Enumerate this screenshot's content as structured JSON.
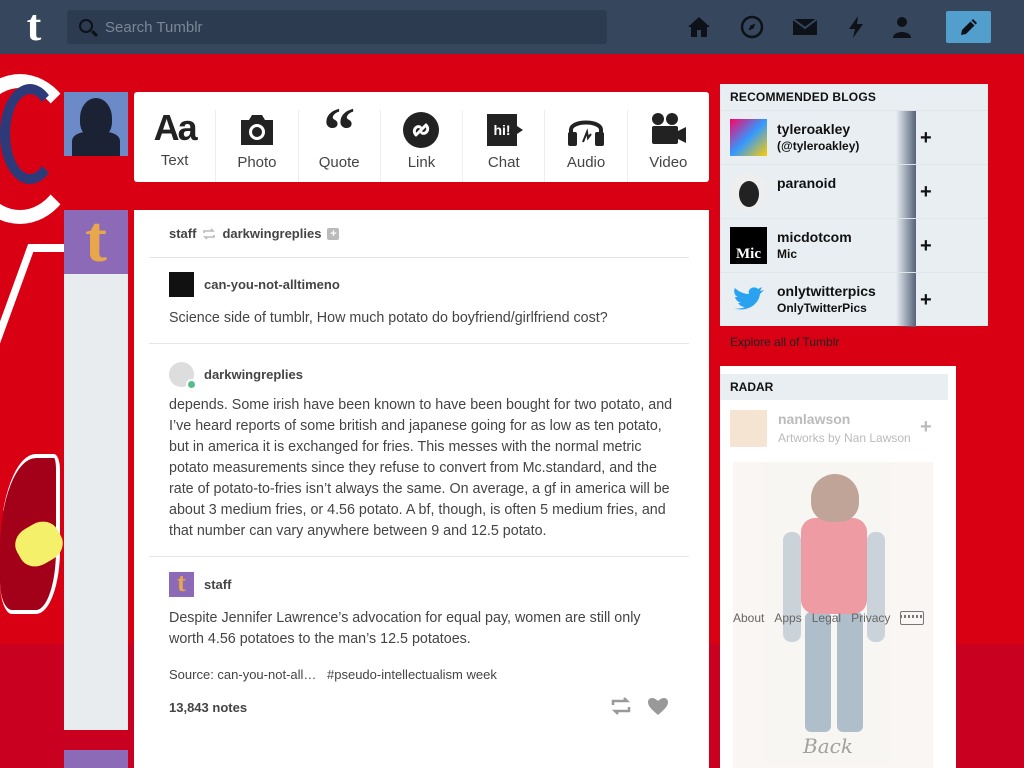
{
  "header": {
    "logo": "t",
    "search_placeholder": "Search Tumblr",
    "nav_icons": [
      "home-icon",
      "explore-compass-icon",
      "mail-icon",
      "activity-lightning-icon",
      "account-person-icon"
    ],
    "compose_icon": "pencil-icon",
    "bar_color": "#36465d",
    "compose_color": "#529ecc"
  },
  "post_types": [
    {
      "label": "Text",
      "icon": "text-aa-icon"
    },
    {
      "label": "Photo",
      "icon": "camera-icon"
    },
    {
      "label": "Quote",
      "icon": "quote-icon"
    },
    {
      "label": "Link",
      "icon": "link-icon"
    },
    {
      "label": "Chat",
      "icon": "chat-bubble-icon"
    },
    {
      "label": "Audio",
      "icon": "headphones-icon"
    },
    {
      "label": "Video",
      "icon": "video-camera-icon"
    }
  ],
  "post": {
    "reblogger": "staff",
    "reblogged_from": "darkwingreplies",
    "follow_plus": "+",
    "trail": [
      {
        "blog": "can-you-not-alltimeno",
        "text": "Science side of tumblr, How much potato do boyfriend/girlfriend cost?"
      },
      {
        "blog": "darkwingreplies",
        "text": "depends. Some irish have been known to have been bought for two potato, and I’ve heard reports of some british and japanese going for as low as ten potato, but in america it is exchanged for fries. This messes with the normal metric potato measurements since they refuse to convert from Mc.standard, and the rate of potato-to-fries isn’t always the same. On average, a gf in america will be about 3 medium fries, or 4.56 potato. A bf, though, is often 5 medium fries, and that number can vary anywhere between 9 and 12.5 potato."
      },
      {
        "blog": "staff",
        "text": "Despite Jennifer Lawrence’s advocation for equal pay, women are still only worth 4.56 potatoes to the man’s 12.5 potatoes."
      }
    ],
    "source": "Source: can-you-not-all…",
    "tag": "#pseudo-intellectualism week",
    "notes": "13,843 notes"
  },
  "sidebar": {
    "recommended_title": "RECOMMENDED BLOGS",
    "recommended": [
      {
        "name": "tyleroakley",
        "sub": "(@tyleroakley)"
      },
      {
        "name": "paranoid",
        "sub": ""
      },
      {
        "name": "micdotcom",
        "sub": "Mic",
        "avatar_text": "Mic"
      },
      {
        "name": "onlytwitterpics",
        "sub": "OnlyTwitterPics"
      }
    ],
    "add_label": "+",
    "explore": "Explore all of Tumblr",
    "radar_title": "RADAR",
    "radar_blog": {
      "name": "nanlawson",
      "sub": "Artworks by Nan Lawson"
    },
    "radar_caption": "Back",
    "footer": [
      "About",
      "Apps",
      "Legal",
      "Privacy"
    ]
  },
  "colors": {
    "background": "#d90013",
    "accent_green": "#56bc8a"
  }
}
